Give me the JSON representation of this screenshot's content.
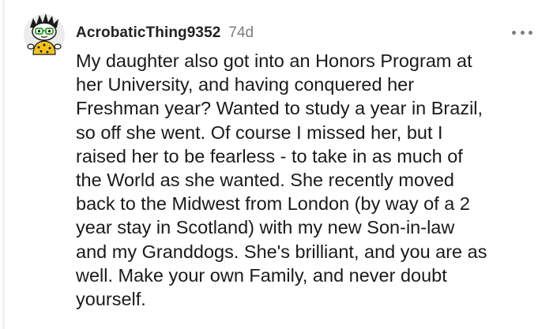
{
  "comment": {
    "author": "AcrobaticThing9352",
    "age": "74d",
    "avatar_icon": "snoo-avatar-icon",
    "more_icon": "more-options-icon",
    "body_lines": [
      "My daughter also got into an Honors Program at",
      "her University, and having conquered her",
      "Freshman year? Wanted to study a year in Brazil,",
      "so off she went. Of course I missed her, but I",
      "raised her to be fearless - to take in as much of",
      "the World as she wanted. She recently moved",
      "back to the Midwest from London (by way of a 2",
      "year stay in Scotland) with my new Son-in-law",
      "and my Granddogs. She's brilliant, and you are as",
      "well. Make your own Family, and never doubt",
      "yourself."
    ]
  },
  "colors": {
    "background": "#ffffff",
    "username": "#222222",
    "meta": "#7c7c7c",
    "body": "#1a1a1a",
    "thread_line": "#f2f2f2"
  }
}
